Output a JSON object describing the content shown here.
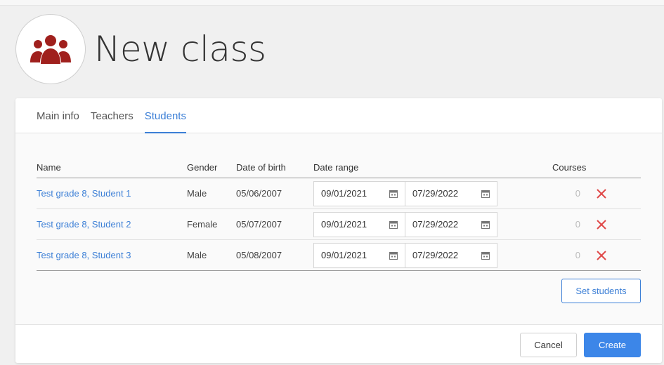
{
  "page": {
    "title": "New class",
    "icon": "users-icon",
    "accent": "#3c7fd6",
    "icon_color": "#a0201d"
  },
  "tabs": [
    {
      "label": "Main info",
      "active": false
    },
    {
      "label": "Teachers",
      "active": false
    },
    {
      "label": "Students",
      "active": true
    }
  ],
  "table": {
    "headers": {
      "name": "Name",
      "gender": "Gender",
      "dob": "Date of birth",
      "range": "Date range",
      "courses": "Courses"
    },
    "rows": [
      {
        "name": "Test grade 8, Student 1",
        "gender": "Male",
        "dob": "05/06/2007",
        "from": "09/01/2021",
        "to": "07/29/2022",
        "courses": "0"
      },
      {
        "name": "Test grade 8, Student 2",
        "gender": "Female",
        "dob": "05/07/2007",
        "from": "09/01/2021",
        "to": "07/29/2022",
        "courses": "0"
      },
      {
        "name": "Test grade 8, Student 3",
        "gender": "Male",
        "dob": "05/08/2007",
        "from": "09/01/2021",
        "to": "07/29/2022",
        "courses": "0"
      }
    ]
  },
  "buttons": {
    "set_students": "Set students",
    "cancel": "Cancel",
    "create": "Create"
  }
}
